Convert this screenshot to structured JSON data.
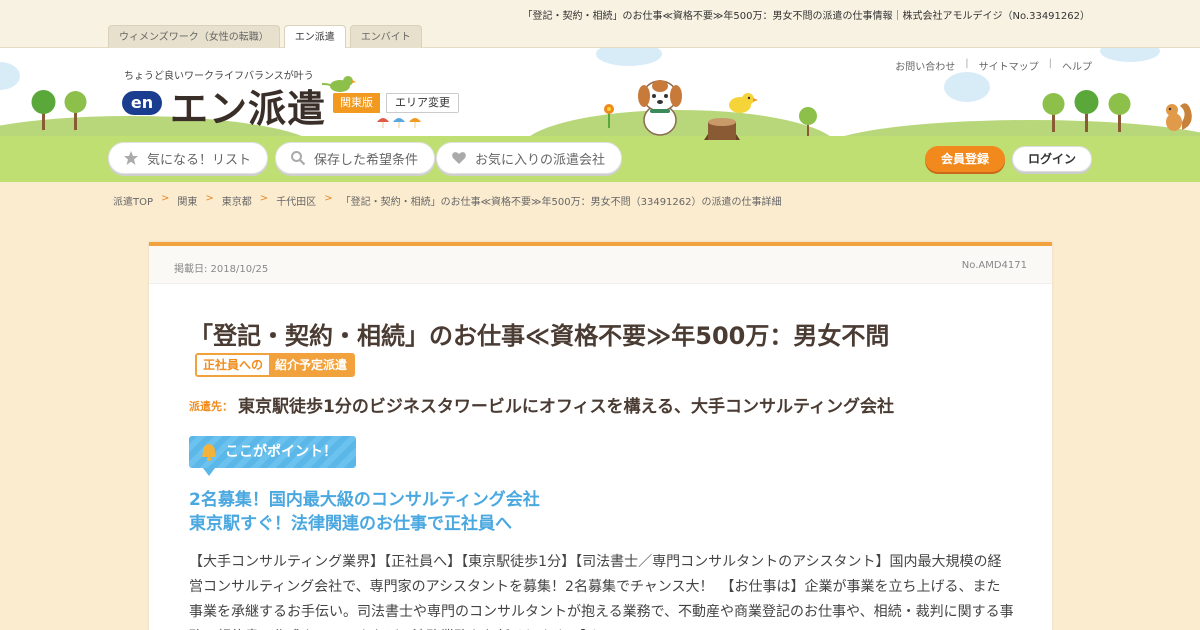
{
  "topbar": {
    "page_heading": "「登記・契約・相続」のお仕事≪資格不要≫年500万：男女不問の派遣の仕事情報｜株式会社アモルデイジ（No.33491262）",
    "tabs": [
      {
        "label": "ウィメンズワーク（女性の転職）",
        "active": false
      },
      {
        "label": "エン派遣",
        "active": true
      },
      {
        "label": "エンバイト",
        "active": false
      }
    ]
  },
  "header": {
    "tagline": "ちょうど良いワークライフバランスが叶う",
    "logo_mark": "en",
    "logo_text": "エン派遣",
    "region": "関東版",
    "area_change": "エリア変更",
    "util_links": [
      "お問い合わせ",
      "サイトマップ",
      "ヘルプ"
    ],
    "nav": {
      "favorites_list": "気になる！リスト",
      "saved_conditions": "保存した希望条件",
      "favorite_companies": "お気に入りの派遣会社"
    },
    "register": "会員登録",
    "login": "ログイン"
  },
  "breadcrumb": [
    "派遣TOP",
    "関東",
    "東京都",
    "千代田区",
    "「登記・契約・相続」のお仕事≪資格不要≫年500万：男女不問（33491262）の派遣の仕事詳細"
  ],
  "job": {
    "posted": "掲載日: 2018/10/25",
    "number": "No.AMD4171",
    "title": "「登記・契約・相続」のお仕事≪資格不要≫年500万：男女不問",
    "badge_left": "正社員への",
    "badge_right": "紹介予定派遣",
    "dest_label": "派遣先：",
    "dest_text": "東京駅徒歩1分のビジネスタワービルにオフィスを構える、大手コンサルティング会社",
    "point_label": "ここがポイント！",
    "catch_line1": "2名募集！国内最大級のコンサルティング会社",
    "catch_line2": "東京駅すぐ！法律関連のお仕事で正社員へ",
    "body": "【大手コンサルティング業界】【正社員へ】【東京駅徒歩1分】【司法書士／専門コンサルタントのアシスタント】国内最大規模の経営コンサルティング会社で、専門家のアシスタントを募集！2名募集でチャンス大！　【お仕事は】企業が事業を立ち上げる、また事業を承継するお手伝い。司法書士や専門のコンサルタントが抱える業務で、不動産や商業登記のお仕事や、相続・裁判に関する事務、契約書の作成やチェックなど、法務業務をお任せします。【オスス"
  },
  "colors": {
    "accent_orange": "#f2891d",
    "point_blue": "#5bb7e7",
    "catch_blue": "#4aa8e0",
    "background": "#fbecd0"
  }
}
